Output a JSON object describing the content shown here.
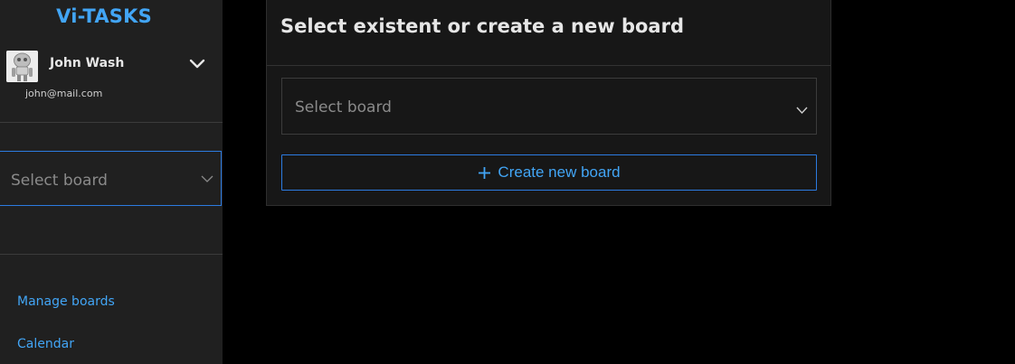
{
  "sidebar": {
    "app_title": "Vi-TASKS",
    "user": {
      "name": "John Wash",
      "email": "john@mail.com",
      "avatar_icon": "robot-avatar-icon",
      "toggle_icon": "chevron-down-icon"
    },
    "board_select": {
      "placeholder": "Select board",
      "icon": "chevron-down-icon"
    },
    "nav": [
      {
        "label": "Manage boards"
      },
      {
        "label": "Calendar"
      }
    ]
  },
  "modal": {
    "title": "Select existent or create a new board",
    "board_select": {
      "placeholder": "Select board",
      "icon": "chevron-down-icon"
    },
    "create_button": {
      "label": "Create new board",
      "icon": "plus-icon"
    }
  },
  "colors": {
    "accent": "#42a5f5",
    "border_accent": "#2c7be0",
    "sidebar_bg": "#202020",
    "card_bg": "#171717",
    "page_bg": "#000000"
  }
}
